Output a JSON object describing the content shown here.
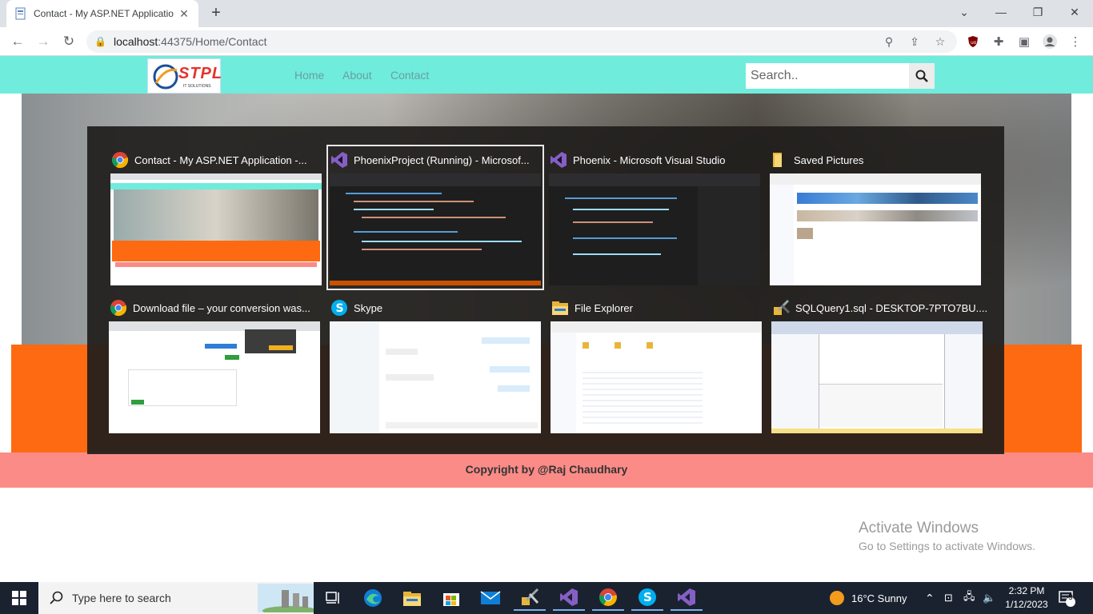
{
  "browser": {
    "tab_title": "Contact - My ASP.NET Applicatio",
    "new_tab_symbol": "+",
    "close_tab_symbol": "✕",
    "url_host": "localhost",
    "url_rest": ":44375/Home/Contact"
  },
  "site": {
    "logo_text": "STPL",
    "logo_sub": "IT SOLUTIONS",
    "nav": [
      "Home",
      "About",
      "Contact"
    ],
    "search_placeholder": "Search..",
    "footer": "Copyright by @Raj Chaudhary",
    "nav_color": "#6fecdc",
    "orange_color": "#fd6a11",
    "footer_color": "#fb8b87"
  },
  "switcher": {
    "windows": [
      {
        "title": "Contact - My ASP.NET Application -...",
        "icon": "chrome-icon",
        "selected": false
      },
      {
        "title": "PhoenixProject (Running) - Microsof...",
        "icon": "visual-studio-icon",
        "selected": true
      },
      {
        "title": "Phoenix - Microsoft Visual Studio",
        "icon": "visual-studio-icon",
        "selected": false
      },
      {
        "title": "Saved Pictures",
        "icon": "folder-icon",
        "selected": false
      },
      {
        "title": "Download file – your conversion was...",
        "icon": "chrome-icon",
        "selected": false
      },
      {
        "title": "Skype",
        "icon": "skype-icon",
        "selected": false
      },
      {
        "title": "File Explorer",
        "icon": "file-explorer-icon",
        "selected": false
      },
      {
        "title": "SQLQuery1.sql - DESKTOP-7PTO7BU....",
        "icon": "ssms-icon",
        "selected": false
      }
    ]
  },
  "activation": {
    "line1": "Activate Windows",
    "line2": "Go to Settings to activate Windows."
  },
  "taskbar": {
    "search_placeholder": "Type here to search",
    "weather": "16°C  Sunny",
    "time": "2:32 PM",
    "date": "1/12/2023",
    "notifications": "9"
  }
}
